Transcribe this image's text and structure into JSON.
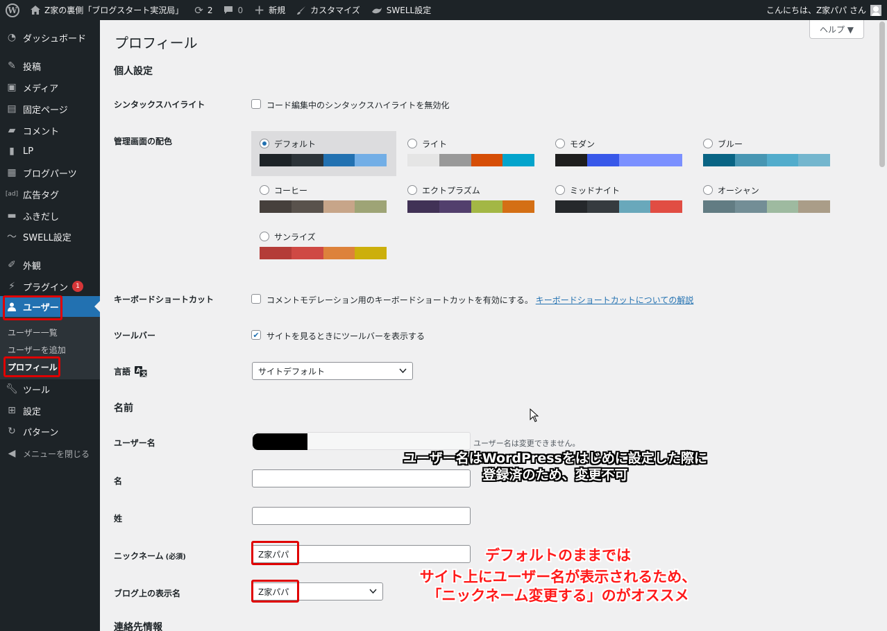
{
  "adminbar": {
    "site_name": "Z家の裏側「ブログスタート実況局」",
    "updates_count": "2",
    "comments_count": "0",
    "new_label": "新規",
    "customize_label": "カスタマイズ",
    "swell_label": "SWELL設定",
    "greeting": "こんにちは、Z家パパ さん"
  },
  "sidebar": {
    "items": [
      {
        "label": "ダッシュボード",
        "icon": "dashboard-icon"
      },
      {
        "label": "投稿",
        "icon": "pin-icon"
      },
      {
        "label": "メディア",
        "icon": "media-icon"
      },
      {
        "label": "固定ページ",
        "icon": "page-icon"
      },
      {
        "label": "コメント",
        "icon": "comment-icon"
      },
      {
        "label": "LP",
        "icon": "document-icon"
      },
      {
        "label": "ブログパーツ",
        "icon": "blocks-icon"
      },
      {
        "label": "広告タグ",
        "icon": "ad-icon"
      },
      {
        "label": "ふきだし",
        "icon": "bubble-icon"
      },
      {
        "label": "SWELL設定",
        "icon": "swell-icon"
      },
      {
        "label": "外観",
        "icon": "brush-icon"
      },
      {
        "label": "プラグイン",
        "icon": "plugin-icon",
        "badge": "1"
      },
      {
        "label": "ユーザー",
        "icon": "user-icon"
      },
      {
        "label": "ツール",
        "icon": "wrench-icon"
      },
      {
        "label": "設定",
        "icon": "settings-icon"
      },
      {
        "label": "パターン",
        "icon": "pattern-icon"
      },
      {
        "label": "メニューを閉じる",
        "icon": "collapse-icon"
      }
    ],
    "submenu": [
      "ユーザー一覧",
      "ユーザーを追加",
      "プロフィール"
    ]
  },
  "help_label": "ヘルプ ▼",
  "page_title": "プロフィール",
  "sections": {
    "personal": "個人設定",
    "name": "名前",
    "contact": "連絡先情報"
  },
  "syntax": {
    "label": "シンタックスハイライト",
    "checkbox_text": "コード編集中のシンタックスハイライトを無効化",
    "checked": false
  },
  "color_scheme": {
    "label": "管理画面の配色",
    "selected": "デフォルト",
    "schemes": [
      {
        "name": "デフォルト",
        "colors": [
          "#1d2327",
          "#2c3338",
          "#2271b1",
          "#72aee6"
        ]
      },
      {
        "name": "ライト",
        "colors": [
          "#e5e5e5",
          "#999999",
          "#d64e07",
          "#04a4cc"
        ]
      },
      {
        "name": "モダン",
        "colors": [
          "#1e1e1e",
          "#3858e9",
          "#7b90ff",
          "#7b90ff"
        ]
      },
      {
        "name": "ブルー",
        "colors": [
          "#096484",
          "#4796b3",
          "#52accc",
          "#74b6ce"
        ]
      },
      {
        "name": "コーヒー",
        "colors": [
          "#46403c",
          "#59524c",
          "#c7a589",
          "#9ea476"
        ]
      },
      {
        "name": "エクトプラズム",
        "colors": [
          "#413256",
          "#523f6d",
          "#a3b745",
          "#d46f15"
        ]
      },
      {
        "name": "ミッドナイト",
        "colors": [
          "#25282b",
          "#363b3f",
          "#69a8bb",
          "#e14d43"
        ]
      },
      {
        "name": "オーシャン",
        "colors": [
          "#627c83",
          "#738e96",
          "#9ebaa0",
          "#aa9d88"
        ]
      },
      {
        "name": "サンライズ",
        "colors": [
          "#b43c38",
          "#cf4944",
          "#dd823b",
          "#ccaf0b"
        ]
      }
    ]
  },
  "keyboard": {
    "label": "キーボードショートカット",
    "checkbox_text": "コメントモデレーション用のキーボードショートカットを有効にする。",
    "link_text": "キーボードショートカットについての解説",
    "checked": false
  },
  "toolbar": {
    "label": "ツールバー",
    "checkbox_text": "サイトを見るときにツールバーを表示する",
    "checked": true,
    "check_glyph": "✔"
  },
  "language": {
    "label": "言語",
    "value": "サイトデフォルト"
  },
  "fields": {
    "username_label": "ユーザー名",
    "username_desc": "ユーザー名は変更できません。",
    "first_name_label": "名",
    "first_name_value": "",
    "last_name_label": "姓",
    "last_name_value": "",
    "nickname_label": "ニックネーム",
    "nickname_required": "(必須)",
    "nickname_value": "Z家パパ",
    "display_name_label": "ブログ上の表示名",
    "display_name_value": "Z家パパ"
  },
  "annotations": {
    "username_note_1": "ユーザー名はWordPressをはじめに設定した際に",
    "username_note_2": "登録済のため、変更不可",
    "nickname_note_1": "デフォルトのままでは",
    "nickname_note_2": "サイト上にユーザー名が表示されるため、",
    "nickname_note_3": "「ニックネーム変更する」のがオススメ"
  },
  "colors": {
    "accent": "#2271b1",
    "annotation_red": "#e00000"
  }
}
